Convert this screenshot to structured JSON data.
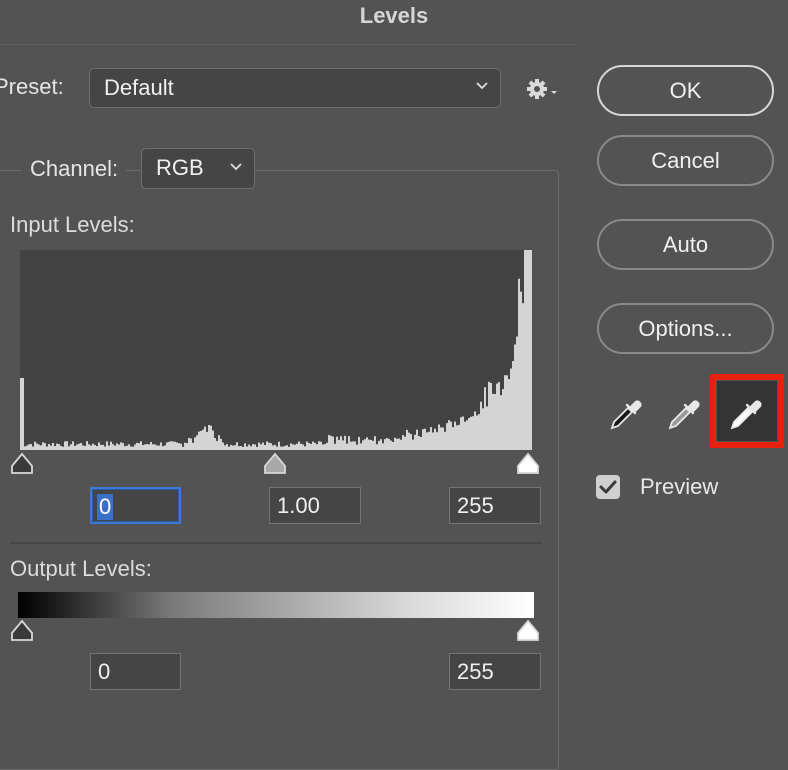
{
  "window": {
    "title": "Levels"
  },
  "preset": {
    "label": "Preset:",
    "value": "Default"
  },
  "channel": {
    "label": "Channel:",
    "value": "RGB"
  },
  "input_levels": {
    "label": "Input Levels:",
    "black": "0",
    "gamma": "1.00",
    "white": "255",
    "black_slider_value": 0,
    "gamma_slider_value": 1.0,
    "white_slider_value": 255
  },
  "output_levels": {
    "label": "Output Levels:",
    "black": "0",
    "white": "255"
  },
  "buttons": {
    "ok": "OK",
    "cancel": "Cancel",
    "auto": "Auto",
    "options": "Options..."
  },
  "eyedroppers": [
    {
      "name": "black-point-eyedropper-icon",
      "tone": "black"
    },
    {
      "name": "gray-point-eyedropper-icon",
      "tone": "gray"
    },
    {
      "name": "white-point-eyedropper-icon",
      "tone": "white",
      "active": true
    }
  ],
  "preview": {
    "label": "Preview",
    "checked": true
  },
  "colors": {
    "dialog_bg": "#535353",
    "field_bg": "#454545",
    "focus_blue": "#3d7ad6",
    "highlight_red": "#e8200e"
  }
}
